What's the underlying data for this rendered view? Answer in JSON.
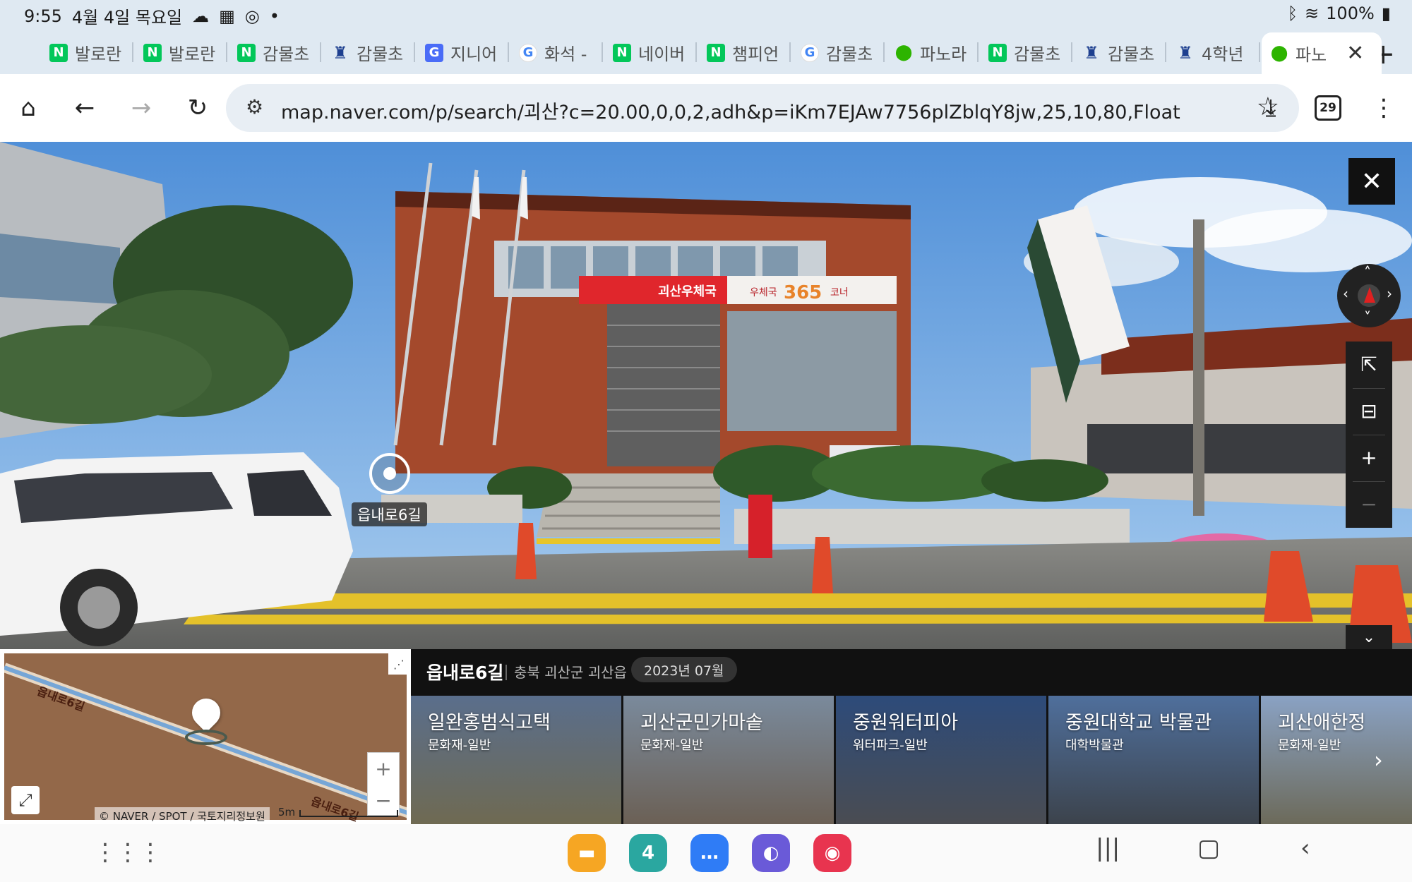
{
  "status": {
    "time": "9:55",
    "date": "4월 4일 목요일",
    "battery": "100%"
  },
  "tabs": [
    {
      "label": "발로란",
      "favicon": "naver-n-icon"
    },
    {
      "label": "발로란",
      "favicon": "naver-n-icon"
    },
    {
      "label": "감물초",
      "favicon": "naver-n-icon"
    },
    {
      "label": "감물초",
      "favicon": "school-shirt-icon"
    },
    {
      "label": "지니어",
      "favicon": "gamma-g-icon"
    },
    {
      "label": "화석 -",
      "favicon": "google-g-icon"
    },
    {
      "label": "네이버",
      "favicon": "naver-n-icon"
    },
    {
      "label": "챔피언",
      "favicon": "naver-n-icon"
    },
    {
      "label": "감물초",
      "favicon": "google-g-icon"
    },
    {
      "label": "파노라",
      "favicon": "naver-map-icon"
    },
    {
      "label": "감물초",
      "favicon": "naver-n-icon"
    },
    {
      "label": "감물초",
      "favicon": "school-shirt-icon"
    },
    {
      "label": "4학년",
      "favicon": "school-shirt-icon"
    },
    {
      "label": "파노",
      "favicon": "naver-map-icon",
      "active": true
    }
  ],
  "toolbar": {
    "url": "map.naver.com/p/search/괴산?c=20.00,0,0,2,adh&p=iKm7EJAw7756plZblqY8jw,25,10,80,Float",
    "tab_count": "29"
  },
  "viewer": {
    "road_label": "읍내로6길",
    "signs": {
      "post_office": "괴산우체국",
      "corner": "우체국",
      "corner_num": "365",
      "corner_suffix": "코너"
    }
  },
  "minimap": {
    "road_label_1": "읍내로6길",
    "road_label_2": "읍내로6길",
    "copyright": "© NAVER / SPOT / 국토지리정보원",
    "scale": "5m"
  },
  "info": {
    "title": "읍내로6길",
    "address": "충북 괴산군 괴산읍",
    "date": "2023년 07월"
  },
  "cards": [
    {
      "name": "일완홍범식고택",
      "category": "문화재-일반",
      "colors": [
        "#5a6e8c",
        "#6f6a52"
      ]
    },
    {
      "name": "괴산군민가마솥",
      "category": "문화재-일반",
      "colors": [
        "#7a8a9c",
        "#6b6055"
      ]
    },
    {
      "name": "중원워터피아",
      "category": "워터파크-일반",
      "colors": [
        "#2d4b7a",
        "#4a4c52"
      ]
    },
    {
      "name": "중원대학교 박물관",
      "category": "대학박물관",
      "colors": [
        "#4f6f9c",
        "#3c434c"
      ]
    },
    {
      "name": "괴산애한정",
      "category": "문화재-일반",
      "colors": [
        "#8aa2c4",
        "#6c6a5a"
      ]
    }
  ],
  "dock": [
    {
      "name": "my-files-app",
      "color": "#f6a623",
      "glyph": "▬"
    },
    {
      "name": "calendar-app",
      "color": "#2aa7a0",
      "glyph": "4"
    },
    {
      "name": "messages-app",
      "color": "#2f7cf6",
      "glyph": "…"
    },
    {
      "name": "internet-app",
      "color": "#6a5ad8",
      "glyph": "◐"
    },
    {
      "name": "screen-recorder-app",
      "color": "#e8344f",
      "glyph": "◉"
    }
  ]
}
